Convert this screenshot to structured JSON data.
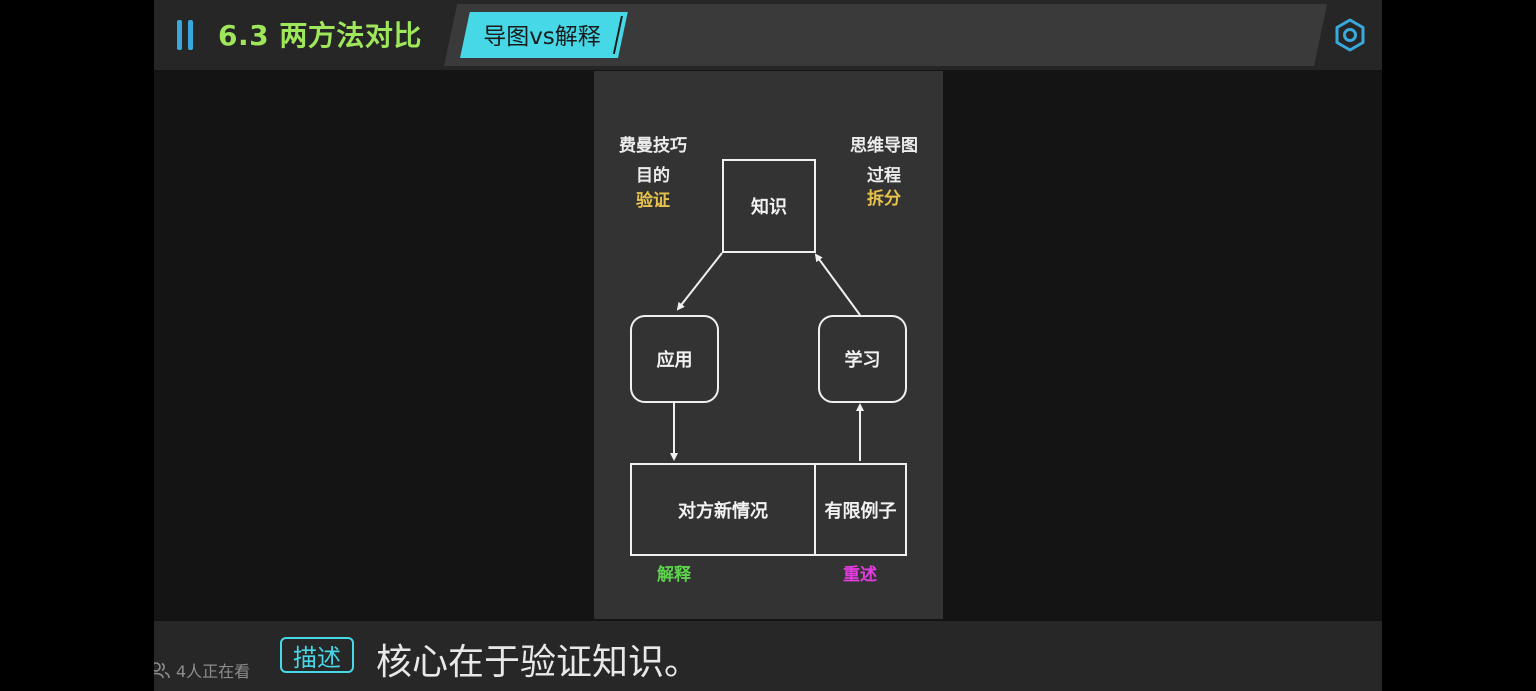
{
  "header": {
    "section_title": "6.3 两方法对比",
    "active_tab": "导图vs解释"
  },
  "diagram": {
    "left_heading": [
      "费曼技巧",
      "目的"
    ],
    "left_keyword": "验证",
    "right_heading": [
      "思维导图",
      "过程"
    ],
    "right_keyword": "拆分",
    "node_top": "知识",
    "node_left": "应用",
    "node_right": "学习",
    "node_bottom_left": "对方新情况",
    "node_bottom_right": "有限例子",
    "label_bottom_left": "解释",
    "label_bottom_right": "重述"
  },
  "footer": {
    "viewers": "4人正在看",
    "badge": "描述",
    "subtitle": "核心在于验证知识。"
  },
  "colors": {
    "accent": "#46d8e6",
    "section_title": "#9ee65a",
    "keyword_yellow": "#e8c34b",
    "label_green": "#5cd34b",
    "label_magenta": "#e43ce0"
  }
}
